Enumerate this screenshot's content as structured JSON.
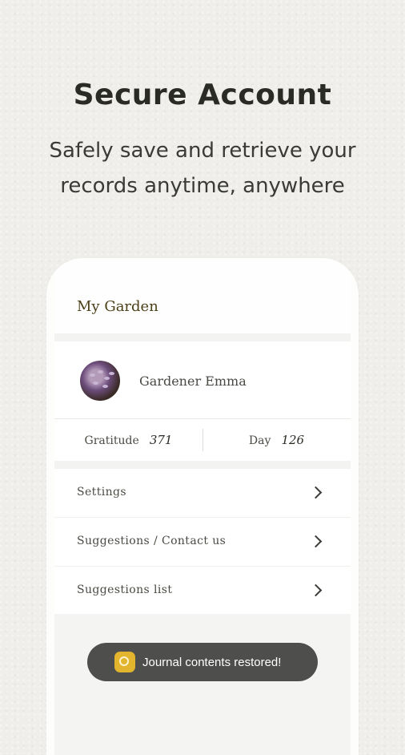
{
  "hero": {
    "title": "Secure Account",
    "subtitle_line1": "Safely save and retrieve your",
    "subtitle_line2": "records anytime, anywhere"
  },
  "app": {
    "header_title": "My Garden",
    "profile": {
      "name": "Gardener Emma"
    },
    "stats": {
      "gratitude_label": "Gratitude",
      "gratitude_value": "371",
      "day_label": "Day",
      "day_value": "126"
    },
    "menu": [
      {
        "label": "Settings"
      },
      {
        "label": "Suggestions / Contact us"
      },
      {
        "label": "Suggestions list"
      }
    ]
  },
  "toast": {
    "icon": "flower-icon",
    "text": "Journal contents restored!",
    "icon_color": "#e3b52f"
  }
}
